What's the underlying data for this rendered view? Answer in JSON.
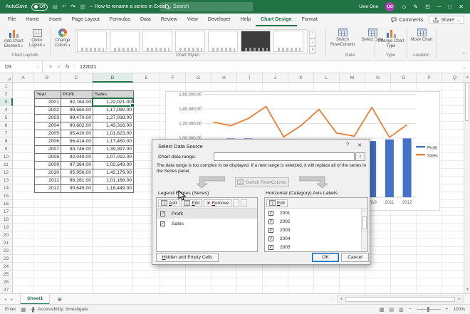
{
  "titlebar": {
    "autosave_label": "AutoSave",
    "autosave_state": "Off",
    "doc_title": "How to rename a series in Excel",
    "search_placeholder": "Search",
    "user_name": "Uwe One",
    "user_initials": "UO"
  },
  "menu": {
    "tabs": [
      "File",
      "Home",
      "Insert",
      "Page Layout",
      "Formulas",
      "Data",
      "Review",
      "View",
      "Developer",
      "Help",
      "Chart Design",
      "Format"
    ],
    "active_tab": "Chart Design",
    "comments": "Comments",
    "share": "Share"
  },
  "ribbon": {
    "chart_layouts": {
      "label": "Chart Layouts",
      "add_chart_element": "Add Chart Element",
      "quick_layout": "Quick Layout"
    },
    "chart_styles": {
      "label": "Chart Styles",
      "change_colors": "Change Colors",
      "style_count": 7,
      "dark_style_index": 5
    },
    "data_group": {
      "label": "Data",
      "switch_row_column": "Switch Row/Column",
      "select_data": "Select Data"
    },
    "type_group": {
      "label": "Type",
      "change_chart_type": "Change Chart Type"
    },
    "location_group": {
      "label": "Location",
      "move_chart": "Move Chart"
    }
  },
  "formula_bar": {
    "name_box": "D3",
    "formula": "122021",
    "fx": "fx"
  },
  "sheet": {
    "col_headers": [
      "A",
      "B",
      "C",
      "D",
      "E",
      "F",
      "G",
      "H",
      "I",
      "J",
      "K",
      "L",
      "M",
      "N",
      "O",
      "P",
      "Q"
    ],
    "row_count": 27,
    "selected_cell": "D3",
    "selected_col": "D",
    "selected_row": 3,
    "table": {
      "headers": [
        "Year",
        "Profit",
        "Sales"
      ],
      "rows": [
        [
          "2001",
          "92,164.00",
          "1,22,021.00"
        ],
        [
          "2002",
          "99,560.00",
          "1,17,090.00"
        ],
        [
          "2003",
          "99,470.00",
          "1,27,038.00"
        ],
        [
          "2004",
          "90,602.00",
          "1,43,316.00"
        ],
        [
          "2005",
          "95,420.00",
          "1,01,623.00"
        ],
        [
          "2006",
          "96,414.00",
          "1,17,450.00"
        ],
        [
          "2007",
          "93,746.00",
          "1,39,397.00"
        ],
        [
          "2008",
          "92,049.00",
          "1,07,012.00"
        ],
        [
          "2009",
          "97,364.00",
          "1,02,643.00"
        ],
        [
          "2010",
          "95,956.00",
          "1,42,179.00"
        ],
        [
          "2011",
          "98,261.00",
          "1,01,168.00"
        ],
        [
          "2012",
          "99,645.00",
          "1,18,449.00"
        ]
      ]
    },
    "tab_name": "Sheet1"
  },
  "chart_data": {
    "type": "combo",
    "categories": [
      "2001",
      "2002",
      "2003",
      "2004",
      "2005",
      "2006",
      "2007",
      "2008",
      "2009",
      "2010",
      "2011",
      "2012"
    ],
    "series": [
      {
        "name": "Profit",
        "type": "bar",
        "color": "#4472c4",
        "values": [
          92164,
          99560,
          99470,
          90602,
          95420,
          96414,
          93746,
          92049,
          97364,
          95956,
          98261,
          99645
        ]
      },
      {
        "name": "Sales",
        "type": "line",
        "color": "#ed7d31",
        "values": [
          122021,
          117090,
          127038,
          143316,
          101623,
          117450,
          139397,
          107012,
          102643,
          142179,
          101168,
          118449
        ]
      }
    ],
    "y_ticks": [
      {
        "value": 100000,
        "label": "1,00,000.00"
      },
      {
        "value": 120000,
        "label": "1,20,000.00"
      },
      {
        "value": 140000,
        "label": "1,40,000.00"
      },
      {
        "value": 160000,
        "label": "1,60,000.00"
      }
    ],
    "legend_position": "right",
    "grid": true
  },
  "dialog": {
    "title": "Select Data Source",
    "range_label": "Chart data range:",
    "range_value": "",
    "warning_text": "The data range is too complex to be displayed. If a new range is selected, it will replace all of the series in the Series panel.",
    "switch_button": "Switch Row/Column",
    "series_section": "Legend Entries (Series)",
    "axis_section": "Horizontal (Category) Axis Labels",
    "add": "Add",
    "edit": "Edit",
    "remove": "Remove",
    "axis_edit": "Edit",
    "series_items": [
      {
        "label": "Profit",
        "checked": true,
        "selected": true
      },
      {
        "label": "Sales",
        "checked": true,
        "selected": false
      }
    ],
    "axis_items": [
      "2001",
      "2002",
      "2003",
      "2004",
      "2005"
    ],
    "hidden_cells": "Hidden and Empty Cells",
    "ok": "OK",
    "cancel": "Cancel"
  },
  "status": {
    "mode": "Enter",
    "accessibility": "Accessibility: Investigate",
    "zoom": "100%"
  }
}
